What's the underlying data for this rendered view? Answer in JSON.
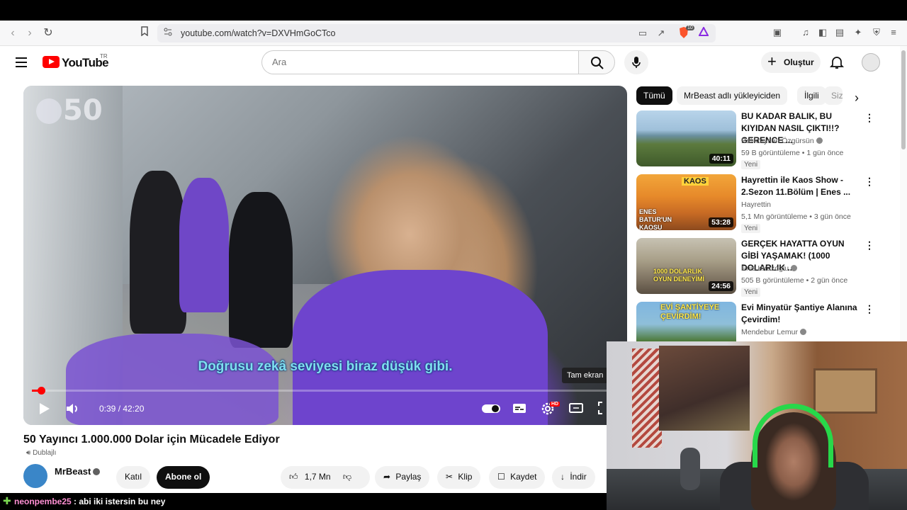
{
  "browser": {
    "url": "youtube.com/watch?v=DXVHmGoCTco",
    "badge_count": "10"
  },
  "header": {
    "logo_text": "YouTube",
    "country_code": "TR",
    "search_placeholder": "Ara",
    "create_label": "Oluştur"
  },
  "video": {
    "counter": "50",
    "subtitle": "Doğrusu zekâ seviyesi biraz düşük gibi.",
    "tooltip": "Tam ekran",
    "time": "0:39 / 42:20",
    "progress_fraction": 0.0153,
    "hd_badge": "HD",
    "title": "50 Yayıncı 1.000.000 Dolar için Mücadele Ediyor",
    "dubbed_label": "Dublajlı"
  },
  "channel": {
    "name": "MrBeast",
    "join_label": "Katıl",
    "subscribe_label": "Abone ol"
  },
  "actions": {
    "likes": "1,7 Mn",
    "share": "Paylaş",
    "clip": "Klip",
    "save": "Kaydet",
    "download": "İndir"
  },
  "chips": [
    "Tümü",
    "MrBeast adlı yükleyiciden",
    "İlgili",
    "Siz"
  ],
  "recommendations": [
    {
      "title": "BU KADAR BALIK, BU KIYIDAN NASIL ÇIKTI!!? GERENCE ...",
      "channel": "Balıktaysan Özgürsün",
      "meta": "59 B görüntüleme • 1 gün önce",
      "badge": "Yeni",
      "duration": "40:11"
    },
    {
      "title": "Hayrettin ile Kaos Show - 2.Sezon 11.Bölüm | Enes ...",
      "channel": "Hayrettin",
      "meta": "5,1 Mn görüntüleme • 3 gün önce",
      "badge": "Yeni",
      "duration": "53:28",
      "thumb_text_top": "KAOS",
      "thumb_text_bottom": "ENES BATUR'UN KAOSU"
    },
    {
      "title": "GERÇEK HAYATTA OYUN GİBİ YAŞAMAK! (1000 DOLARLIK ...",
      "channel": "Enis Kirazoglu",
      "meta": "505 B görüntüleme • 2 gün önce",
      "badge": "Yeni",
      "duration": "24:56",
      "thumb_text": "1000 DOLARLIK OYUN DENEYİMİ"
    },
    {
      "title": "Evi Minyatür Şantiye Alanına Çevirdim!",
      "channel": "Mendebur Lemur",
      "thumb_text": "EVİ ŞANTİYEYE ÇEVİRDİM!"
    }
  ],
  "chat": {
    "user": "neonpembe25",
    "message": ": abi iki istersin bu ney"
  },
  "colors": {
    "brand_red": "#ff0000",
    "subtitle": "#7fdff0",
    "chat_user": "#ff8fd3",
    "headset_green": "#27d84a"
  }
}
